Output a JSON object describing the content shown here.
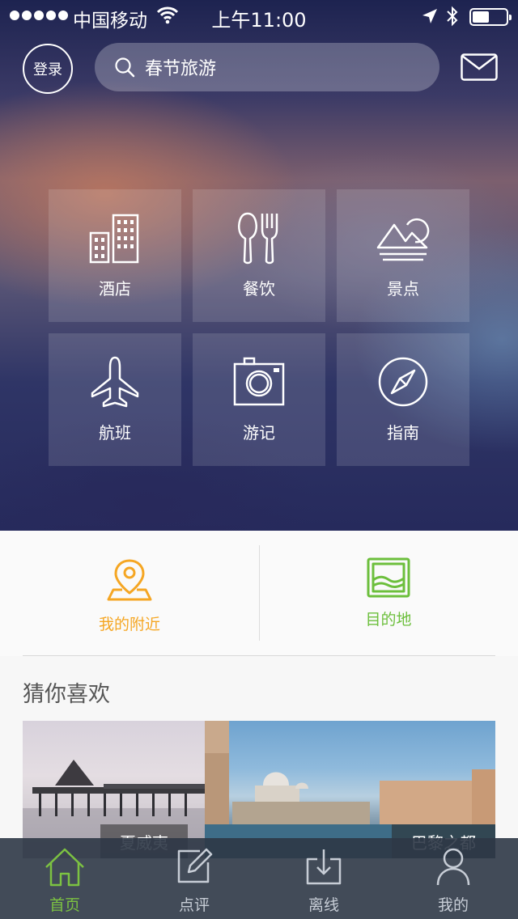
{
  "status_bar": {
    "carrier": "中国移动",
    "time": "上午11:00"
  },
  "header": {
    "login_label": "登录",
    "search_placeholder": "春节旅游"
  },
  "categories": [
    {
      "label": "酒店",
      "icon": "hotel-building-icon"
    },
    {
      "label": "餐饮",
      "icon": "spoon-fork-icon"
    },
    {
      "label": "景点",
      "icon": "mountain-sun-icon"
    },
    {
      "label": "航班",
      "icon": "airplane-icon"
    },
    {
      "label": "游记",
      "icon": "camera-icon"
    },
    {
      "label": "指南",
      "icon": "compass-icon"
    }
  ],
  "quick_entries": [
    {
      "label": "我的附近",
      "color": "#f5a623",
      "icon": "location-pin-icon"
    },
    {
      "label": "目的地",
      "color": "#6cbf3c",
      "icon": "landscape-picture-icon"
    }
  ],
  "guess_section": {
    "title": "猜你喜欢",
    "cards": [
      {
        "label": "夏威夷"
      },
      {
        "label": "巴黎之都"
      }
    ]
  },
  "tab_bar": {
    "tabs": [
      {
        "label": "首页",
        "icon": "home-icon",
        "active": true
      },
      {
        "label": "点评",
        "icon": "edit-review-icon",
        "active": false
      },
      {
        "label": "离线",
        "icon": "download-icon",
        "active": false
      },
      {
        "label": "我的",
        "icon": "user-icon",
        "active": false
      }
    ],
    "active_color": "#7cc242"
  }
}
